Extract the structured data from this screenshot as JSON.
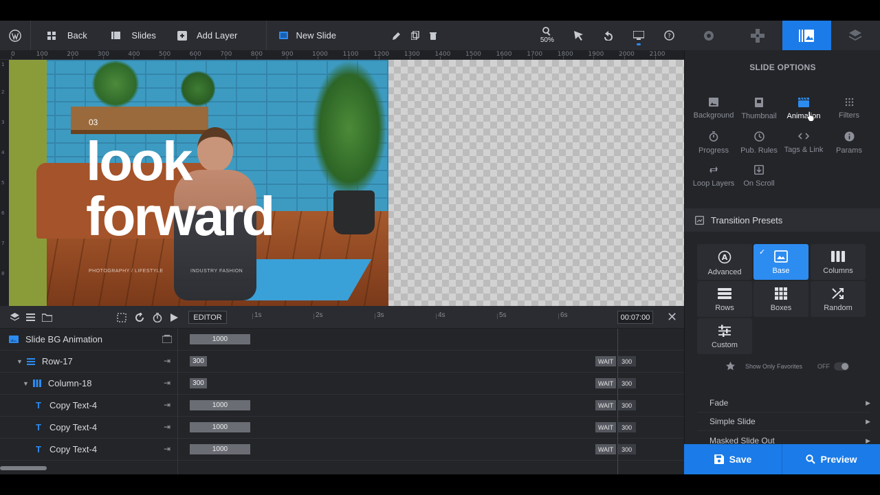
{
  "toolbar": {
    "back_label": "Back",
    "slides_label": "Slides",
    "add_layer_label": "Add Layer",
    "slide_name": "New Slide",
    "zoom": "50%"
  },
  "ruler_ticks": [
    "0",
    "100",
    "200",
    "300",
    "400",
    "500",
    "600",
    "700",
    "800",
    "900",
    "1000",
    "1100",
    "1200",
    "1300",
    "1400",
    "1500",
    "1600",
    "1700",
    "1800",
    "1900",
    "2000",
    "2100"
  ],
  "canvas": {
    "slide_number": "03",
    "headline_line1": "look",
    "headline_line2": "forward",
    "caption_left": "PHOTOGRAPHY / LIFESTYLE",
    "caption_right": "INDUSTRY FASHION"
  },
  "timeline": {
    "editor_tab": "EDITOR",
    "time_ticks": [
      "1s",
      "2s",
      "3s",
      "4s",
      "5s",
      "6s"
    ],
    "current_time": "00:07:00",
    "rows": [
      {
        "name": "Slide BG Animation",
        "bar": "1000",
        "wait": "",
        "wait_value": ""
      },
      {
        "name": "Row-17",
        "bar": "300",
        "wait": "WAIT",
        "wait_value": "300"
      },
      {
        "name": "Column-18",
        "bar": "300",
        "wait": "WAIT",
        "wait_value": "300"
      },
      {
        "name": "Copy Text-4",
        "bar": "1000",
        "wait": "WAIT",
        "wait_value": "300"
      },
      {
        "name": "Copy Text-4",
        "bar": "1000",
        "wait": "WAIT",
        "wait_value": "300"
      },
      {
        "name": "Copy Text-4",
        "bar": "1000",
        "wait": "WAIT",
        "wait_value": "300"
      }
    ]
  },
  "panel": {
    "title": "SLIDE OPTIONS",
    "options": [
      "Background",
      "Thumbnail",
      "Animation",
      "Filters",
      "Progress",
      "Pub. Rules",
      "Tags & Link",
      "Params",
      "Loop Layers",
      "On Scroll"
    ],
    "active_option": "Animation",
    "section_title": "Transition Presets",
    "presets": [
      "Advanced",
      "Base",
      "Columns",
      "Rows",
      "Boxes",
      "Random",
      "Custom"
    ],
    "active_preset": "Base",
    "favorites_label": "Show Only Favorites",
    "favorites_state": "OFF",
    "transitions": [
      "Fade",
      "Simple Slide",
      "Masked Slide Out"
    ]
  },
  "actions": {
    "save_label": "Save",
    "preview_label": "Preview"
  },
  "colors": {
    "accent": "#1b7be8",
    "panel_bg": "#232529",
    "toolbar_bg": "#2a2c31"
  }
}
